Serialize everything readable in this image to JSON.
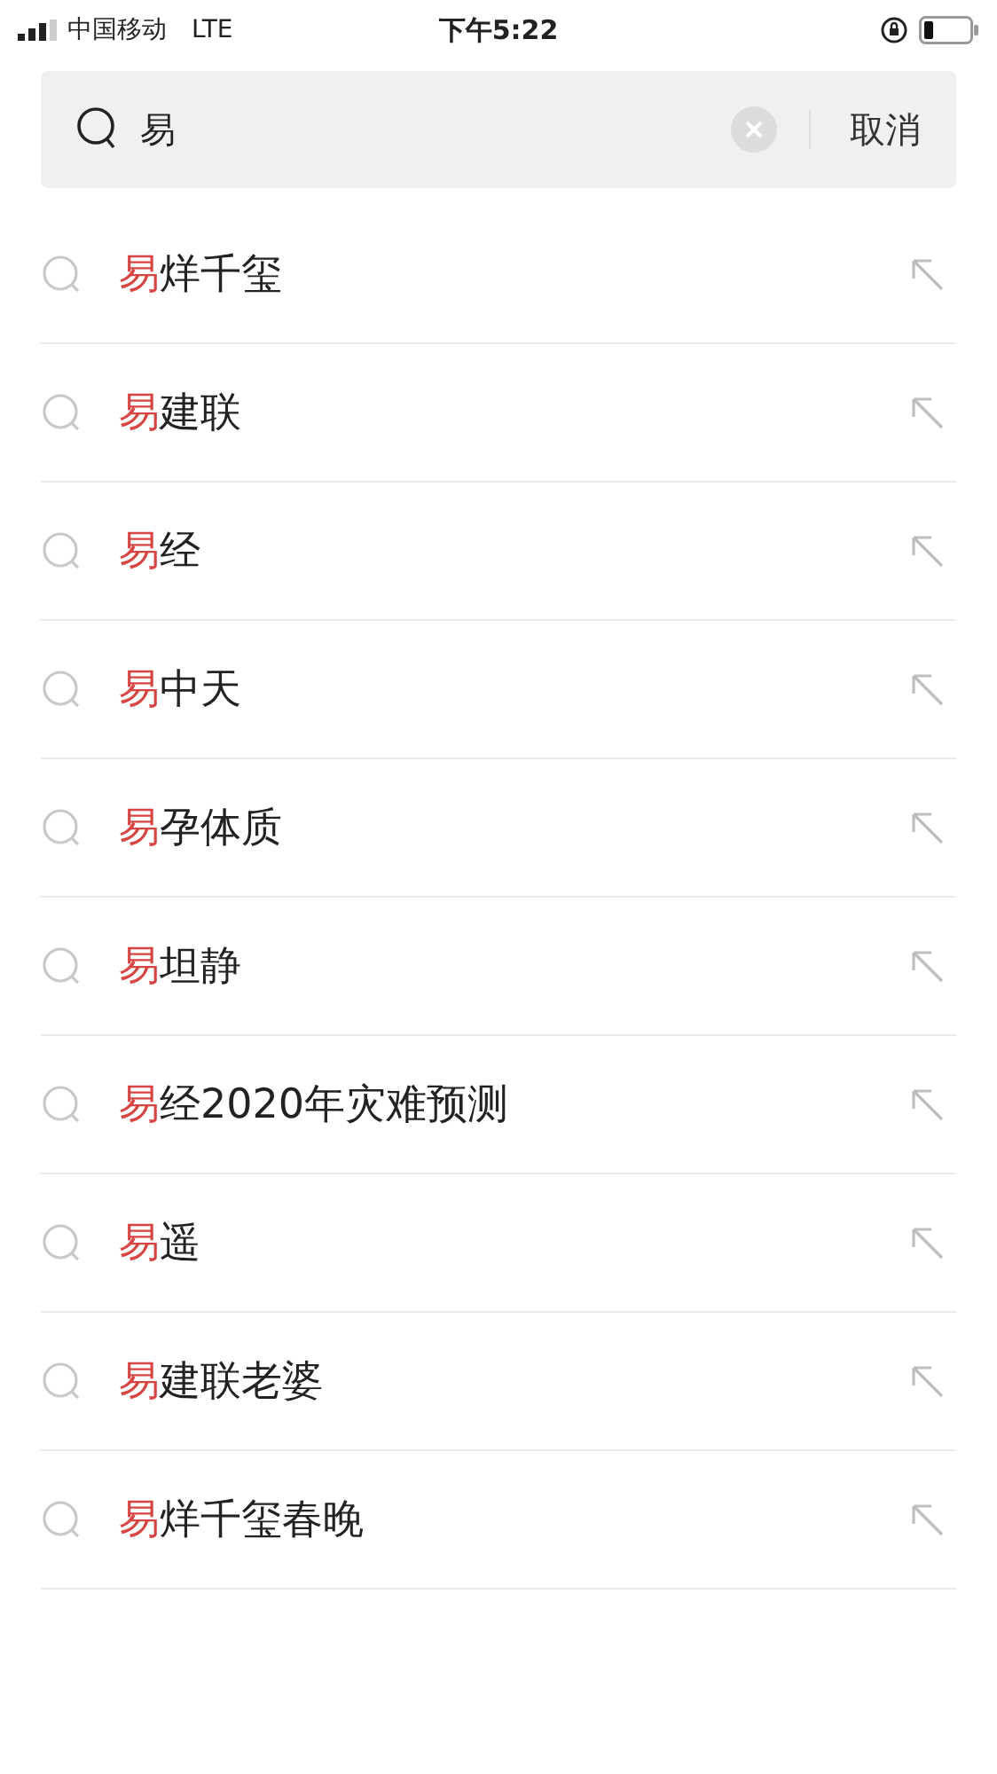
{
  "status_bar": {
    "carrier": "中国移动",
    "network": "LTE",
    "time": "下午5:22"
  },
  "search": {
    "value": "易",
    "cancel": "取消"
  },
  "suggestions": [
    {
      "match": "易",
      "rest": "烊千玺"
    },
    {
      "match": "易",
      "rest": "建联"
    },
    {
      "match": "易",
      "rest": "经"
    },
    {
      "match": "易",
      "rest": "中天"
    },
    {
      "match": "易",
      "rest": "孕体质"
    },
    {
      "match": "易",
      "rest": "坦静"
    },
    {
      "match": "易",
      "rest": "经2020年灾难预测"
    },
    {
      "match": "易",
      "rest": "遥"
    },
    {
      "match": "易",
      "rest": "建联老婆"
    },
    {
      "match": "易",
      "rest": "烊千玺春晚"
    }
  ]
}
